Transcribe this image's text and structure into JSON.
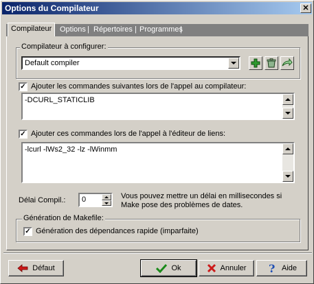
{
  "window": {
    "title": "Options du Compilateur",
    "close_glyph": "✕"
  },
  "tabs": [
    {
      "label": "Compilateur",
      "active": true
    },
    {
      "label": "Options",
      "active": false
    },
    {
      "label": "Répertoires",
      "active": false
    },
    {
      "label": "Programmes",
      "active": false
    }
  ],
  "tab_separator": "|",
  "compiler_group": {
    "label": "Compilateur à configurer:",
    "selected": "Default compiler",
    "buttons": [
      {
        "name": "add-compiler",
        "icon": "plus-icon"
      },
      {
        "name": "delete-compiler",
        "icon": "trash-icon"
      },
      {
        "name": "rename-compiler",
        "icon": "arrow-icon"
      }
    ]
  },
  "compiler_commands": {
    "checked": true,
    "label": "Ajouter les commandes suivantes lors de l'appel au compilateur:",
    "value": "-DCURL_STATICLIB"
  },
  "linker_commands": {
    "checked": true,
    "label": "Ajouter ces commandes lors de l'appel à l'éditeur de liens:",
    "value": "-lcurl -lWs2_32 -lz -lWinmm"
  },
  "delay": {
    "label": "Délai Compil.:",
    "value": "0",
    "hint_line1": "Vous pouvez mettre un délai en millisecondes si",
    "hint_line2": "Make pose des problèmes de dates."
  },
  "makefile": {
    "group_label": "Génération de Makefile:",
    "checked": true,
    "option_label": "Génération des dépendances rapide (imparfaite)"
  },
  "footer": {
    "default_label": "Défaut",
    "ok_label": "Ok",
    "cancel_label": "Annuler",
    "help_label": "Aide"
  },
  "colors": {
    "title_start": "#0a246a",
    "title_end": "#a6caf0",
    "face": "#d4d0c8",
    "plus_green": "#2e9a2e",
    "cancel_red": "#cc1a1a",
    "help_blue": "#1f4fb4"
  }
}
